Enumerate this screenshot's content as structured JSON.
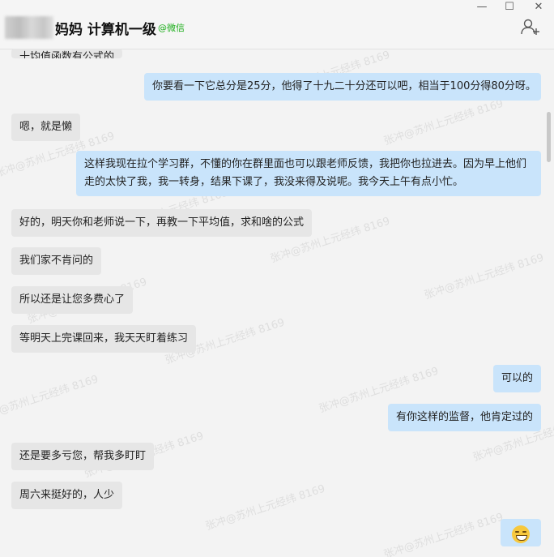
{
  "window": {
    "title": "妈妈 计算机一级",
    "source_tag": "@微信",
    "controls": [
      "—",
      "☐",
      "✕"
    ]
  },
  "messages": [
    {
      "side": "left",
      "text": "十均值函数有公式的",
      "partial": true
    },
    {
      "side": "right",
      "text": "你要看一下它总分是25分，他得了十九二十分还可以吧，相当于100分得80分呀。"
    },
    {
      "side": "left",
      "text": "嗯，就是懒"
    },
    {
      "side": "right",
      "text": "这样我现在拉个学习群，不懂的你在群里面也可以跟老师反馈，我把你也拉进去。因为早上他们走的太快了我，我一转身，结果下课了，我没来得及说呢。我今天上午有点小忙。"
    },
    {
      "side": "left",
      "text": "好的，明天你和老师说一下，再教一下平均值，求和啥的公式"
    },
    {
      "side": "left",
      "text": "我们家不肯问的"
    },
    {
      "side": "left",
      "text": "所以还是让您多费心了"
    },
    {
      "side": "left",
      "text": "等明天上完课回来，我天天盯着练习"
    },
    {
      "side": "right",
      "text": "可以的"
    },
    {
      "side": "right",
      "text": "有你这样的监督，他肯定过的"
    },
    {
      "side": "left",
      "text": "还是要多亏您，帮我多盯盯"
    },
    {
      "side": "left",
      "text": "周六来挺好的，人少"
    },
    {
      "side": "right",
      "emoji": "grin-sweat-emoji"
    }
  ],
  "watermark": "张冲@苏州上元经纬 8169"
}
